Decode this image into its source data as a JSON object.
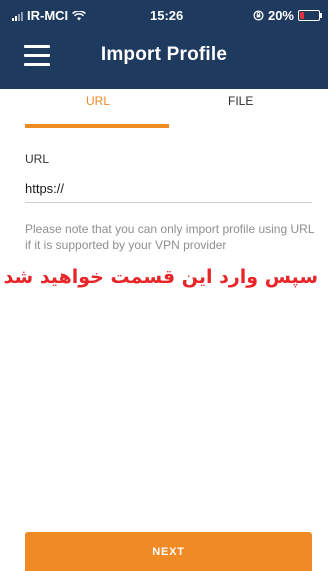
{
  "status_bar": {
    "carrier": "IR-MCI",
    "time": "15:26",
    "battery_percent": "20%",
    "battery_level": 0.2,
    "battery_color": "#e6323c",
    "icons": [
      "signal-icon",
      "wifi-icon",
      "orientation-lock-icon",
      "battery-icon"
    ]
  },
  "header": {
    "title": "Import Profile",
    "menu_icon": "hamburger-menu-icon",
    "background_color": "#1f3a5f"
  },
  "tabs": [
    {
      "label": "URL",
      "active": true
    },
    {
      "label": "FILE",
      "active": false
    }
  ],
  "accent_color": "#f08a24",
  "form": {
    "url_label": "URL",
    "url_value": "https://",
    "note": "Please note that you can only import profile using URL if it is supported by your VPN provider"
  },
  "annotation": {
    "text": "سپس  وارد این قسمت خواهید شد",
    "color": "#e8262a"
  },
  "next_button": {
    "label": "NEXT"
  }
}
